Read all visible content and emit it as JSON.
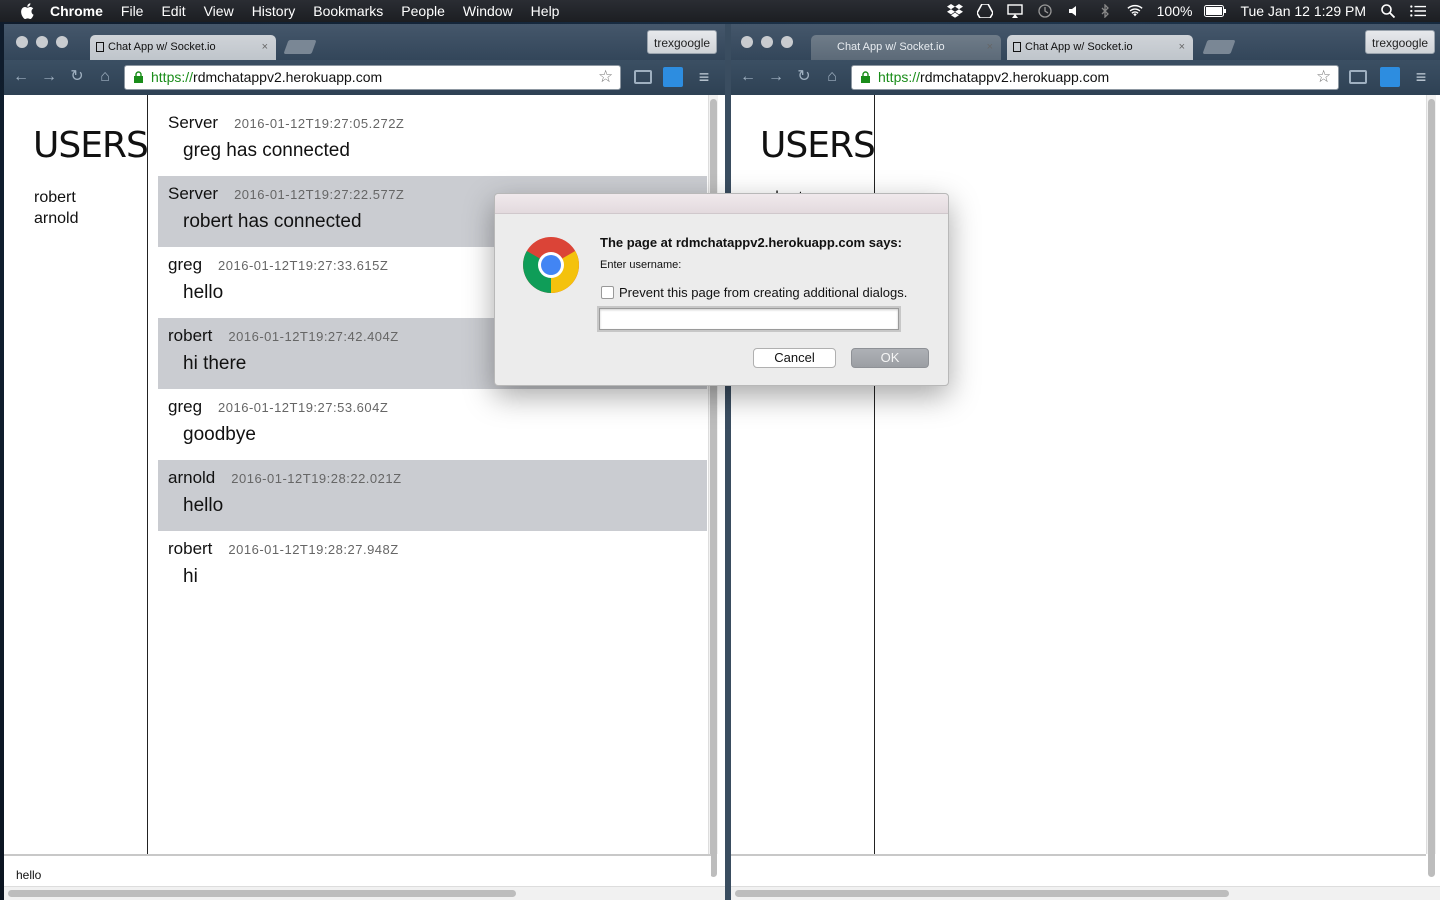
{
  "menubar": {
    "app_name": "Chrome",
    "items": [
      "File",
      "Edit",
      "View",
      "History",
      "Bookmarks",
      "People",
      "Window",
      "Help"
    ],
    "battery": "100%",
    "clock": "Tue Jan 12  1:29 PM"
  },
  "left_window": {
    "tab_title": "Chat App w/ Socket.io",
    "profile": "trexgoogle",
    "url_scheme": "https://",
    "url_host": "rdmchatappv2.herokuapp.com",
    "users_title": "USERS",
    "users": [
      "robert",
      "arnold"
    ],
    "messages": [
      {
        "user": "Server",
        "timestamp": "2016-01-12T19:27:05.272Z",
        "text": "greg has connected"
      },
      {
        "user": "Server",
        "timestamp": "2016-01-12T19:27:22.577Z",
        "text": "robert has connected"
      },
      {
        "user": "greg",
        "timestamp": "2016-01-12T19:27:33.615Z",
        "text": "hello"
      },
      {
        "user": "robert",
        "timestamp": "2016-01-12T19:27:42.404Z",
        "text": "hi there"
      },
      {
        "user": "greg",
        "timestamp": "2016-01-12T19:27:53.604Z",
        "text": "goodbye"
      },
      {
        "user": "arnold",
        "timestamp": "2016-01-12T19:28:22.021Z",
        "text": "hello"
      },
      {
        "user": "robert",
        "timestamp": "2016-01-12T19:28:27.948Z",
        "text": "hi"
      }
    ],
    "input_value": "hello"
  },
  "right_window": {
    "tabs": [
      "Chat App w/ Socket.io",
      "Chat App w/ Socket.io"
    ],
    "profile": "trexgoogle",
    "url_scheme": "https://",
    "url_host": "rdmchatappv2.herokuapp.com",
    "users_title": "USERS",
    "users": [
      "robert"
    ]
  },
  "dialog": {
    "heading": "The page at rdmchatappv2.herokuapp.com says:",
    "prompt": "Enter username:",
    "checkbox_label": "Prevent this page from creating additional dialogs.",
    "input_value": "",
    "cancel_label": "Cancel",
    "ok_label": "OK"
  }
}
